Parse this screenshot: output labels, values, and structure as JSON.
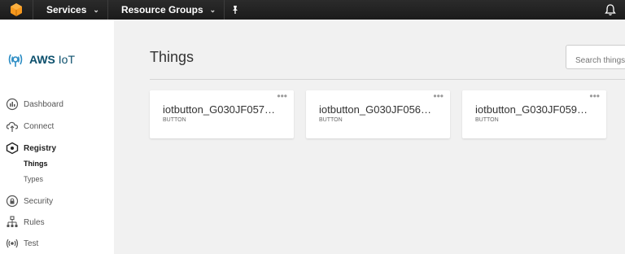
{
  "topbar": {
    "services_label": "Services",
    "resource_groups_label": "Resource Groups"
  },
  "sidebar": {
    "brand": "AWS IoT",
    "items": [
      {
        "label": "Dashboard"
      },
      {
        "label": "Connect"
      },
      {
        "label": "Registry"
      },
      {
        "label": "Security"
      },
      {
        "label": "Rules"
      },
      {
        "label": "Test"
      }
    ],
    "sub_items": [
      {
        "label": "Things"
      },
      {
        "label": "Types"
      }
    ]
  },
  "main": {
    "title": "Things",
    "search_placeholder": "Search things",
    "cards": [
      {
        "name": "iotbutton_G030JF057…",
        "type": "BUTTON",
        "menu": "•••"
      },
      {
        "name": "iotbutton_G030JF056…",
        "type": "BUTTON",
        "menu": "•••"
      },
      {
        "name": "iotbutton_G030JF059…",
        "type": "BUTTON",
        "menu": "•••"
      }
    ]
  }
}
